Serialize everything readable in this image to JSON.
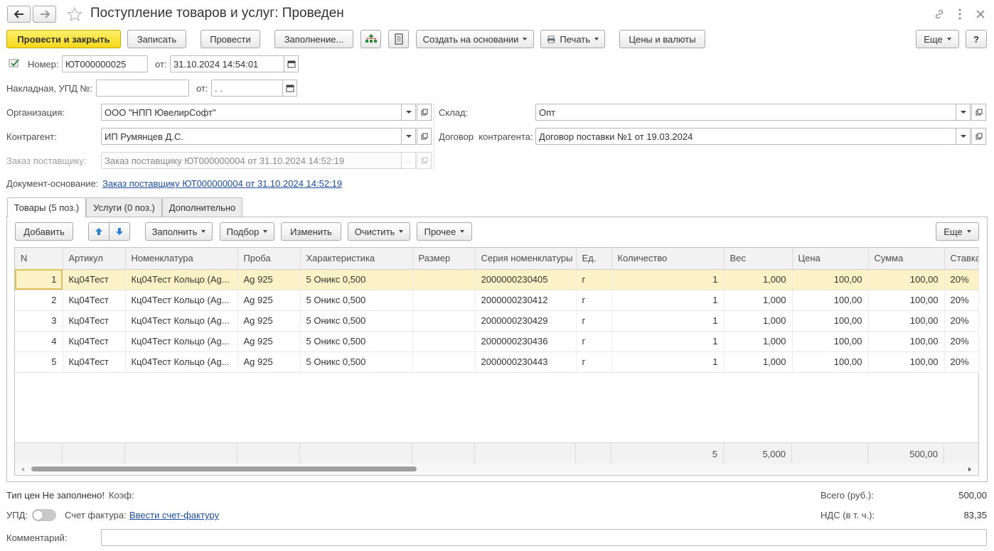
{
  "title": "Поступление товаров и услуг: Проведен",
  "toolbar": {
    "post_close": "Провести и закрыть",
    "save": "Записать",
    "post": "Провести",
    "fill": "Заполнение...",
    "create_based": "Создать на основании",
    "print": "Печать",
    "prices": "Цены и валюты",
    "more": "Еще",
    "help": "?"
  },
  "header": {
    "number_label": "Номер:",
    "number_value": "ЮТ000000025",
    "date_label": "от:",
    "date_value": "31.10.2024 14:54:01",
    "invoice_label": "Накладная, УПД №:",
    "invoice_value": "",
    "invoice_date_label": "от:",
    "invoice_date_value": " .  .",
    "org_label": "Организация:",
    "org_value": "ООО \"НПП ЮвелирСофт\"",
    "warehouse_label": "Склад:",
    "warehouse_value": "Опт",
    "contractor_label": "Контрагент:",
    "contractor_value": "ИП Румянцев Д.С.",
    "contract_label": "Договор  контрагента:",
    "contract_value": "Договор поставки №1 от 19.03.2024",
    "order_label": "Заказ поставщику:",
    "order_value": "Заказ поставщику ЮТ000000004 от 31.10.2024 14:52:19",
    "basis_label": "Документ-основание:",
    "basis_link": "Заказ поставщику ЮТ000000004 от 31.10.2024 14:52:19"
  },
  "tabs": [
    {
      "label": "Товары (5 поз.)"
    },
    {
      "label": "Услуги (0 поз.)"
    },
    {
      "label": "Дополнительно"
    }
  ],
  "table_toolbar": {
    "add": "Добавить",
    "fill": "Заполнить",
    "pick": "Подбор",
    "edit": "Изменить",
    "clear": "Очистить",
    "other": "Прочее",
    "more": "Еще"
  },
  "table": {
    "columns": [
      "N",
      "Артикул",
      "Номенклатура",
      "Проба",
      "Характеристика",
      "Размер",
      "Серия номенклатуры",
      "Ед.",
      "Количество",
      "Вес",
      "Цена",
      "Сумма",
      "Ставка"
    ],
    "rows": [
      [
        "1",
        "Кц04Тест",
        "Кц04Тест Кольцо (Ag...",
        "Ag 925",
        "5 Оникс 0,500",
        "",
        "2000000230405",
        "г",
        "1",
        "1,000",
        "100,00",
        "100,00",
        "20%"
      ],
      [
        "2",
        "Кц04Тест",
        "Кц04Тест Кольцо (Ag...",
        "Ag 925",
        "5 Оникс 0,500",
        "",
        "2000000230412",
        "г",
        "1",
        "1,000",
        "100,00",
        "100,00",
        "20%"
      ],
      [
        "3",
        "Кц04Тест",
        "Кц04Тест Кольцо (Ag...",
        "Ag 925",
        "5 Оникс 0,500",
        "",
        "2000000230429",
        "г",
        "1",
        "1,000",
        "100,00",
        "100,00",
        "20%"
      ],
      [
        "4",
        "Кц04Тест",
        "Кц04Тест Кольцо (Ag...",
        "Ag 925",
        "5 Оникс 0,500",
        "",
        "2000000230436",
        "г",
        "1",
        "1,000",
        "100,00",
        "100,00",
        "20%"
      ],
      [
        "5",
        "Кц04Тест",
        "Кц04Тест Кольцо (Ag...",
        "Ag 925",
        "5 Оникс 0,500",
        "",
        "2000000230443",
        "г",
        "1",
        "1,000",
        "100,00",
        "100,00",
        "20%"
      ]
    ],
    "totals": {
      "quantity": "5",
      "weight": "5,000",
      "sum": "500,00"
    }
  },
  "footer": {
    "price_type": "Тип цен Не заполнено!",
    "coef_label": "Коэф:",
    "total_label": "Всего (руб.):",
    "total_value": "500,00",
    "upd_label": "УПД:",
    "invoice_label": "Счет фактура:",
    "invoice_link": "Ввести счет-фактуру",
    "vat_label": "НДС (в т. ч.):",
    "vat_value": "83,35",
    "comment_label": "Комментарий:",
    "comment_value": ""
  },
  "icons": {
    "back": "arrow-left-icon",
    "forward": "arrow-right-icon",
    "favorite": "star-icon",
    "link": "link-icon",
    "menu": "more-vertical-icon",
    "close": "close-icon",
    "posted": "posted-document-icon",
    "calendar": "calendar-icon",
    "open": "open-form-icon",
    "print": "printer-icon",
    "up": "arrow-up-icon",
    "down": "arrow-down-icon"
  },
  "colors": {
    "primary_button": "#f5d71a",
    "selected_row": "#fbf3c7",
    "link": "#1a4da1"
  }
}
